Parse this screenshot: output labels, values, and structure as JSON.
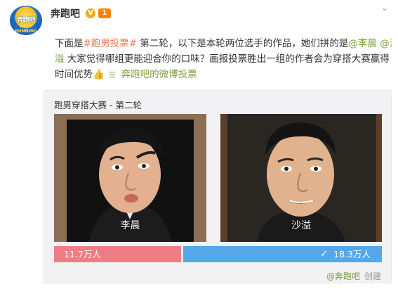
{
  "account": {
    "username": "奔跑吧",
    "avatar_text": "奔跑吧",
    "avatar_sub": "KEEP RUNNING",
    "verified_icon": "verified-badge-icon",
    "vip_label": "1",
    "menu_icon": "chevron-down-icon"
  },
  "post": {
    "line1_prefix": "下面是",
    "hashtag": "#跑男投票#",
    "line1_mid": " 第二轮，以下是本轮两位选手的作品，她们拼的是",
    "mention1": "@李晨",
    "space": " ",
    "mention2_part1": "@沙",
    "line2_mention2_part2": "溢",
    "line2_text": " 大家觉得哪组更能迎合你的口味？画报投票胜出一组的作者会为穿搭大赛赢得",
    "line3_text": "时间优势",
    "line3_emoji": "👍",
    "vote_source_icon": "vote-icon",
    "vote_source": "奔跑吧的微博投票"
  },
  "vote": {
    "title": "跑男穿搭大赛 - 第二轮",
    "option_a": {
      "label": "李晨",
      "count": "11.7万人",
      "share": 0.39
    },
    "option_b": {
      "label": "沙溢",
      "count": "18.3万人",
      "share": 0.61
    },
    "check_icon": "checkmark-icon",
    "author": "@奔跑吧",
    "created": "创建",
    "colors": {
      "a": "#f07d83",
      "b": "#56a6ea"
    }
  }
}
